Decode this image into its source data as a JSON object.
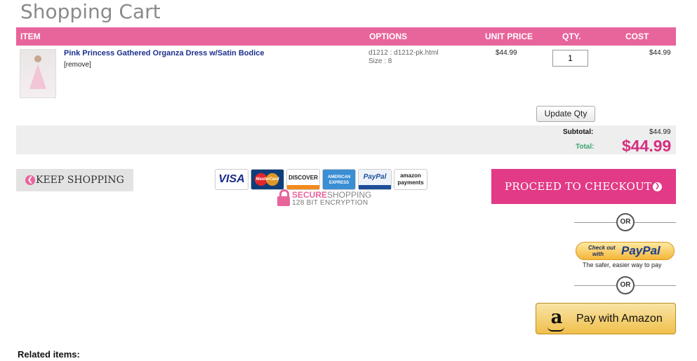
{
  "page": {
    "title": "Shopping Cart"
  },
  "table": {
    "headers": [
      "ITEM",
      "OPTIONS",
      "UNIT PRICE",
      "QTY.",
      "COST"
    ],
    "row": {
      "product_name": "Pink Princess Gathered Organza Dress w/Satin Bodice",
      "remove_label": "[remove]",
      "option_line1": "d1212 : d1212-pk.html",
      "option_line2": "Size : 8",
      "unit_price": "$44.99",
      "qty": "1",
      "cost": "$44.99"
    }
  },
  "update_label": "Update Qty",
  "totals": {
    "subtotal_label": "Subtotal:",
    "subtotal_value": "$44.99",
    "total_label": "Total:",
    "total_value": "$44.99"
  },
  "keep_shopping_label": "KEEP SHOPPING",
  "payment_cards": [
    "VISA",
    "MasterCard",
    "DISCOVER",
    "AMERICAN EXPRESS",
    "PayPal",
    "amazon payments"
  ],
  "secure": {
    "line1_a": "SECURE",
    "line1_b": "SHOPPING",
    "line2": "128 BIT ENCRYPTION"
  },
  "proceed_label": "PROCEED TO CHECKOUT",
  "or_label": "OR",
  "paypal": {
    "line1": "Check out",
    "line2": "with",
    "brand": "PayPal",
    "tagline": "The safer, easier way to pay"
  },
  "amazon_label": "Pay with Amazon",
  "related_label": "Related items:",
  "colors": {
    "accent": "#e8659c",
    "proceed": "#e23a86",
    "total_label": "#3aa36f",
    "total_value": "#d62f80",
    "link": "#1b2f8c"
  },
  "icons": [
    "chevron-left-circle-icon",
    "chevron-right-circle-icon",
    "lock-icon",
    "amazon-logo-icon"
  ]
}
